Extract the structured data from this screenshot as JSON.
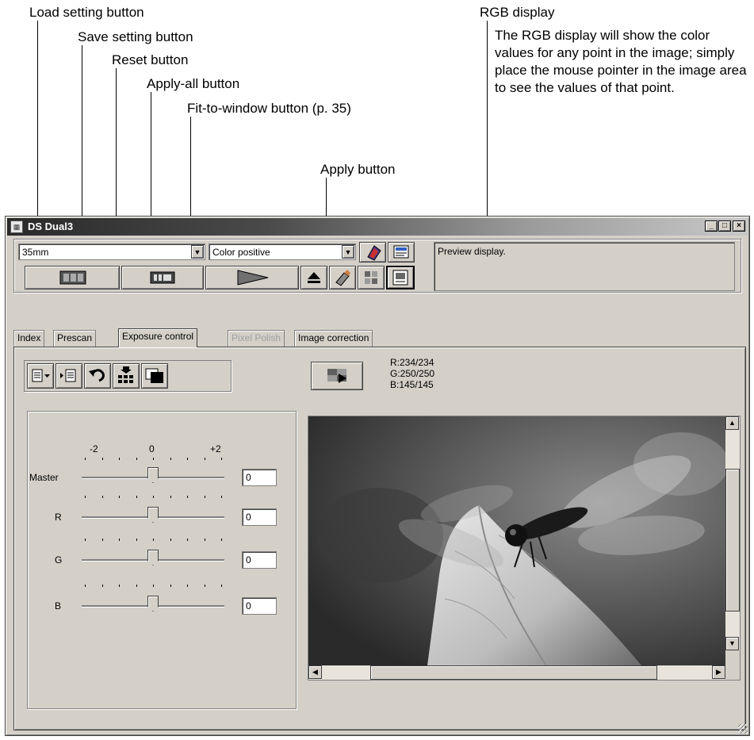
{
  "callouts": {
    "load_setting": "Load setting button",
    "save_setting": "Save setting button",
    "reset": "Reset button",
    "apply_all": "Apply-all button",
    "fit_to_window": "Fit-to-window button (p. 35)",
    "apply": "Apply button",
    "rgb_display": "RGB display",
    "rgb_description": "The RGB display will show the color values for any point in the image; simply place the mouse pointer in the image area to see the values of that point."
  },
  "window": {
    "title": "DS Dual3",
    "controls": {
      "minimize": "_",
      "maximize": "□",
      "close": "×"
    }
  },
  "top_panel": {
    "film_format": "35mm",
    "film_type": "Color positive",
    "status_text": "Preview display."
  },
  "tabs": [
    {
      "label": "Index",
      "state": "normal"
    },
    {
      "label": "Prescan",
      "state": "normal"
    },
    {
      "label": "Exposure control",
      "state": "active"
    },
    {
      "label": "Pixel Polish",
      "state": "disabled"
    },
    {
      "label": "Image correction",
      "state": "normal"
    }
  ],
  "rgb": {
    "r": "R:234/234",
    "g": "G:250/250",
    "b": "B:145/145"
  },
  "sliders": {
    "scale": {
      "min": "-2",
      "mid": "0",
      "max": "+2"
    },
    "items": [
      {
        "label": "Master",
        "value": "0"
      },
      {
        "label": "R",
        "value": "0"
      },
      {
        "label": "G",
        "value": "0"
      },
      {
        "label": "B",
        "value": "0"
      }
    ]
  },
  "icons": {
    "load": "load-setting-icon",
    "save": "save-setting-icon",
    "reset": "undo-arrow-icon",
    "apply_all": "apply-all-icon",
    "fit": "fit-to-window-icon",
    "apply": "apply-icon"
  }
}
